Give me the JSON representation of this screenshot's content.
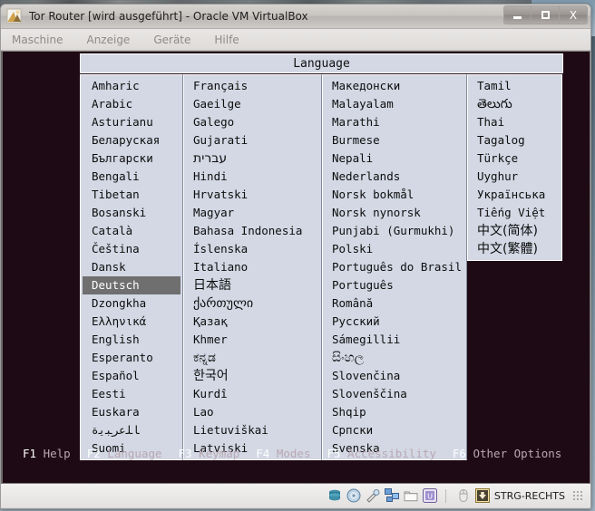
{
  "window": {
    "title": "Tor Router [wird ausgeführt] - Oracle VM VirtualBox",
    "icon": "virtualbox-vm-icon",
    "buttons": {
      "minimize": "minimize-button",
      "maximize": "maximize-button",
      "close_label": "X"
    }
  },
  "menubar": {
    "items": [
      {
        "label": "Maschine"
      },
      {
        "label": "Anzeige"
      },
      {
        "label": "Geräte"
      },
      {
        "label": "Hilfe"
      }
    ]
  },
  "installer": {
    "header": "Language",
    "selected": "Deutsch",
    "columns": [
      {
        "name": "column-1",
        "items": [
          "Amharic",
          "Arabic",
          "Asturianu",
          "Беларуская",
          "Български",
          "Bengali",
          "Tibetan",
          "Bosanski",
          "Català",
          "Čeština",
          "Dansk",
          "Deutsch",
          "Dzongkha",
          "Ελληνικά",
          "English",
          "Esperanto",
          "Español",
          "Eesti",
          "Euskara",
          "ﺎﻠﻋﺮﺒﻳﺓ",
          "Suomi"
        ]
      },
      {
        "name": "column-2",
        "items": [
          "Français",
          "Gaeilge",
          "Galego",
          "Gujarati",
          "עברית",
          "Hindi",
          "Hrvatski",
          "Magyar",
          "Bahasa Indonesia",
          "Íslenska",
          "Italiano",
          "日本語",
          "ქართული",
          "Қазақ",
          "Khmer",
          "ಕನ್ನಡ",
          "한국어",
          "Kurdî",
          "Lao",
          "Lietuviškai",
          "Latviski"
        ]
      },
      {
        "name": "column-3",
        "items": [
          "Македонски",
          "Malayalam",
          "Marathi",
          "Burmese",
          "Nepali",
          "Nederlands",
          "Norsk bokmål",
          "Norsk nynorsk",
          "Punjabi (Gurmukhi)",
          "Polski",
          "Português do Brasil",
          "Português",
          "Română",
          "Русский",
          "Sámegillii",
          "සිංහල",
          "Slovenčina",
          "Slovenščina",
          "Shqip",
          "Српски",
          "Svenska"
        ]
      },
      {
        "name": "column-4",
        "items": [
          "Tamil",
          "తెలుగు",
          "Thai",
          "Tagalog",
          "Türkçe",
          "Uyghur",
          "Українська",
          "Tiếng Việt",
          "中文(简体)",
          "中文(繁體)"
        ]
      }
    ],
    "function_keys": [
      {
        "key": "F1",
        "label": "Help"
      },
      {
        "key": "F2",
        "label": "Language"
      },
      {
        "key": "F3",
        "label": "Keymap"
      },
      {
        "key": "F4",
        "label": "Modes"
      },
      {
        "key": "F5",
        "label": "Accessibility"
      },
      {
        "key": "F6",
        "label": "Other Options"
      }
    ]
  },
  "statusbar": {
    "icons": [
      "hard-disk-icon",
      "optical-disk-icon",
      "usb-icon",
      "network-icon",
      "shared-folders-icon",
      "video-capture-icon",
      "mouse-pointer-icon",
      "host-key-icon"
    ],
    "host_key": "STRG-RECHTS",
    "grip": "resize-grip"
  },
  "colors": {
    "panel_bg": "#d3d8e4",
    "console_bg": "#1e0a14",
    "selection_bg": "#6f6f6f",
    "fkey_label": "#b8a8b2"
  }
}
